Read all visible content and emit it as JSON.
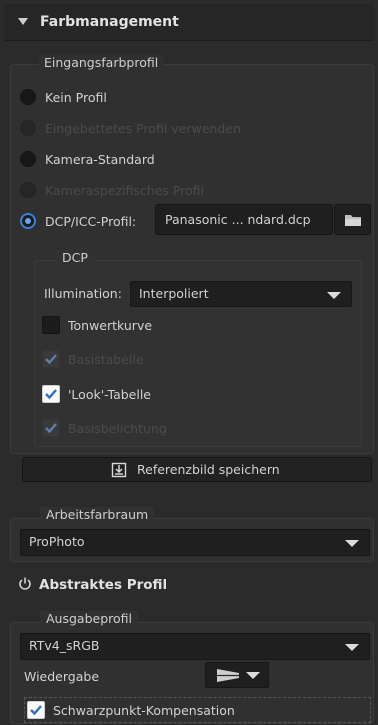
{
  "panel": {
    "title": "Farbmanagement"
  },
  "input_profile": {
    "legend": "Eingangsfarbprofil",
    "options": [
      {
        "label": "Kein Profil",
        "selected": false,
        "disabled": false
      },
      {
        "label": "Eingebettetes Profil verwenden",
        "selected": false,
        "disabled": true
      },
      {
        "label": "Kamera-Standard",
        "selected": false,
        "disabled": false
      },
      {
        "label": "Kameraspezifisches Profil",
        "selected": false,
        "disabled": true
      },
      {
        "label": "DCP/ICC-Profil:",
        "selected": true,
        "disabled": false
      }
    ],
    "profile_file": "Panasonic ... ndard.dcp"
  },
  "dcp": {
    "legend": "DCP",
    "illumination_label": "Illumination:",
    "illumination_value": "Interpoliert",
    "checks": [
      {
        "label": "Tonwertkurve",
        "checked": false,
        "disabled": false
      },
      {
        "label": "Basistabelle",
        "checked": true,
        "disabled": true
      },
      {
        "label": "'Look'-Tabelle",
        "checked": true,
        "disabled": false
      },
      {
        "label": "Basisbelichtung",
        "checked": true,
        "disabled": true
      }
    ]
  },
  "save_reference_label": "Referenzbild speichern",
  "working_space": {
    "legend": "Arbeitsfarbraum",
    "value": "ProPhoto"
  },
  "abstract_profile": {
    "title": "Abstraktes Profil"
  },
  "output_profile": {
    "legend": "Ausgabeprofil",
    "value": "RTv4_sRGB",
    "rendering_label": "Wiedergabe",
    "blackpoint_label": "Schwarzpunkt-Kompensation",
    "blackpoint_checked": true
  },
  "colors": {
    "accent": "#3b7fd8",
    "background": "#2b2b2b"
  }
}
